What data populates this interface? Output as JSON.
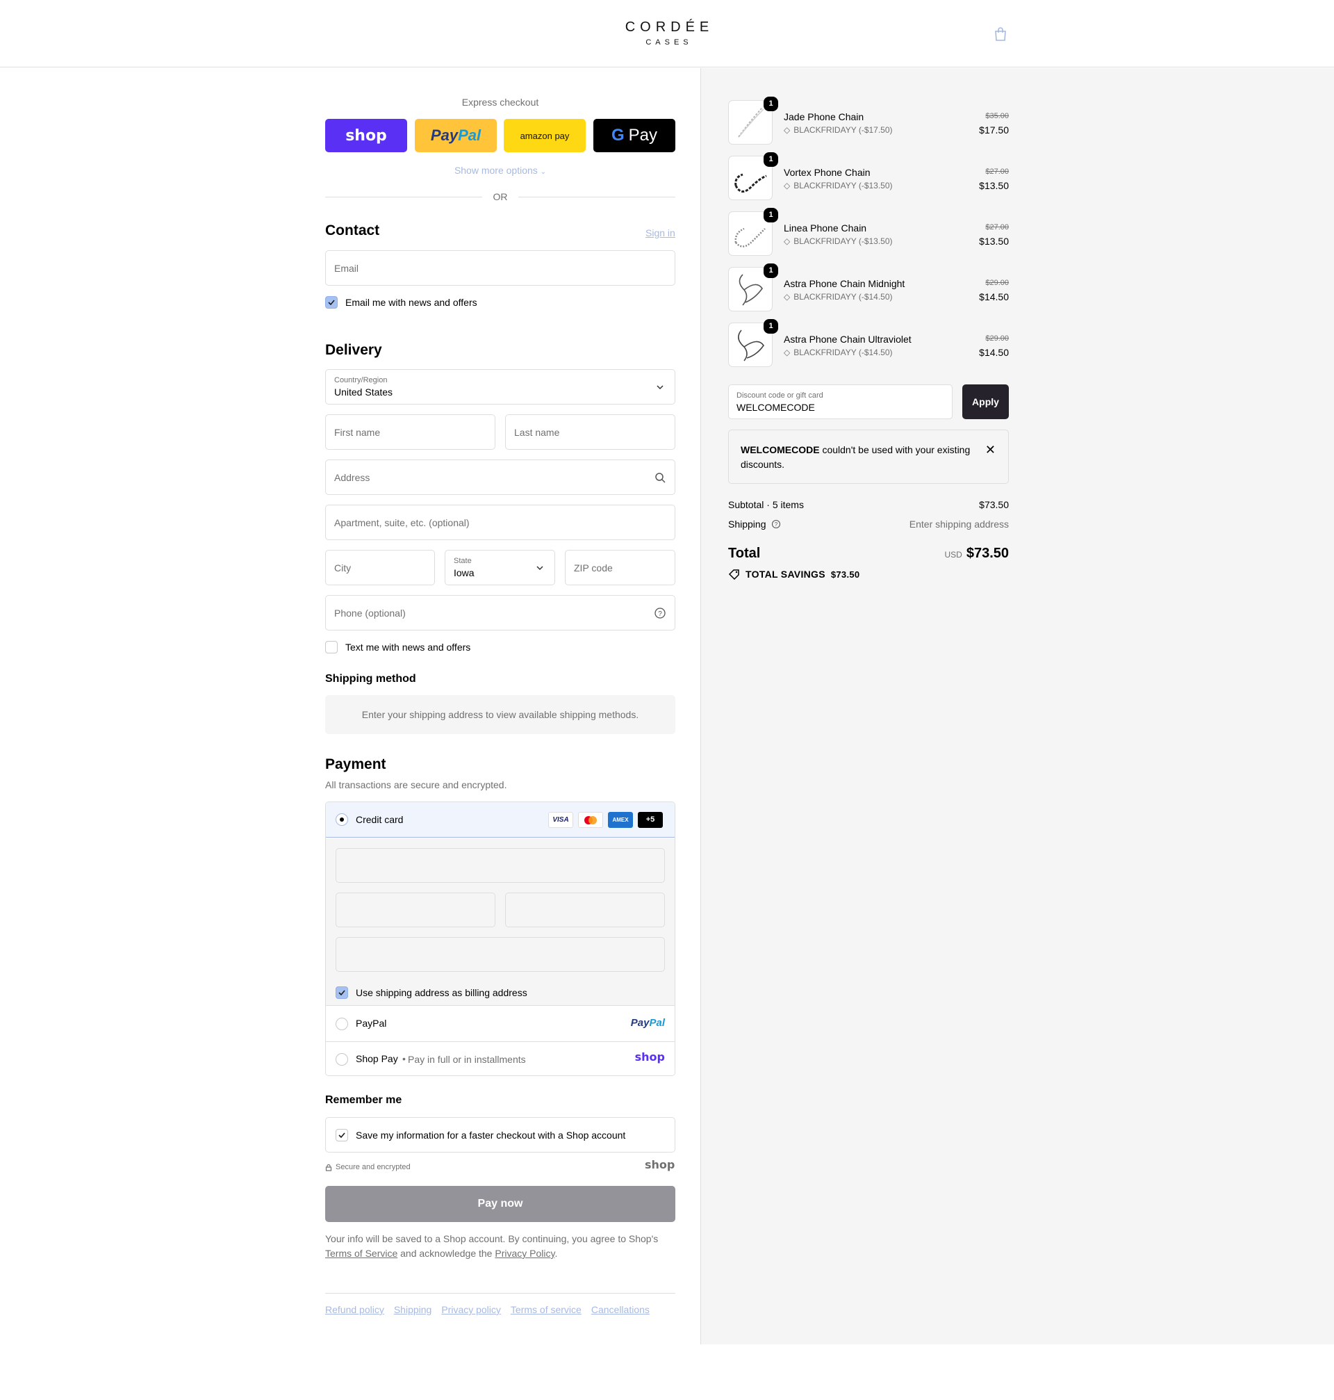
{
  "brand": {
    "name": "CORDÉE",
    "sub": "CASES"
  },
  "express": {
    "title": "Express checkout",
    "shop": "shop",
    "paypal_a": "Pay",
    "paypal_b": "Pal",
    "amazon": "amazon pay",
    "gpay": "Pay",
    "show_more": "Show more options",
    "or": "OR"
  },
  "contact": {
    "title": "Contact",
    "sign_in": "Sign in",
    "email_placeholder": "Email",
    "news_label": "Email me with news and offers"
  },
  "delivery": {
    "title": "Delivery",
    "country_label": "Country/Region",
    "country_value": "United States",
    "first_name": "First name",
    "last_name": "Last name",
    "address": "Address",
    "apartment": "Apartment, suite, etc. (optional)",
    "city": "City",
    "state_label": "State",
    "state_value": "Iowa",
    "zip": "ZIP code",
    "phone": "Phone (optional)",
    "text_label": "Text me with news and offers"
  },
  "shipping_method": {
    "title": "Shipping method",
    "message": "Enter your shipping address to view available shipping methods."
  },
  "payment": {
    "title": "Payment",
    "subtitle": "All transactions are secure and encrypted.",
    "credit_card": "Credit card",
    "cards": [
      "VISA",
      "",
      "AMEX",
      "+5"
    ],
    "billing_label": "Use shipping address as billing address",
    "paypal": "PayPal",
    "paypal_logo_a": "Pay",
    "paypal_logo_b": "Pal",
    "shop_pay": "Shop Pay",
    "shop_pay_sub": "Pay in full or in installments",
    "shop_logo": "shop"
  },
  "remember": {
    "title": "Remember me",
    "save_label": "Save my information for a faster checkout with a Shop account",
    "secure": "Secure and encrypted",
    "shop_logo": "shop"
  },
  "pay_now": "Pay now",
  "legal": {
    "pre": "Your info will be saved to a Shop account. By continuing, you agree to Shop's",
    "terms": "Terms of Service",
    "mid": "and acknowledge the",
    "privacy": "Privacy Policy",
    "end": "."
  },
  "footer_links": [
    "Refund policy",
    "Shipping",
    "Privacy policy",
    "Terms of service",
    "Cancellations"
  ],
  "items": [
    {
      "name": "Jade Phone Chain",
      "qty": "1",
      "discount": "BLACKFRIDAYY (-$17.50)",
      "old": "$35.00",
      "price": "$17.50"
    },
    {
      "name": "Vortex Phone Chain",
      "qty": "1",
      "discount": "BLACKFRIDAYY (-$13.50)",
      "old": "$27.00",
      "price": "$13.50"
    },
    {
      "name": "Linea Phone Chain",
      "qty": "1",
      "discount": "BLACKFRIDAYY (-$13.50)",
      "old": "$27.00",
      "price": "$13.50"
    },
    {
      "name": "Astra Phone Chain Midnight",
      "qty": "1",
      "discount": "BLACKFRIDAYY (-$14.50)",
      "old": "$29.00",
      "price": "$14.50"
    },
    {
      "name": "Astra Phone Chain Ultraviolet",
      "qty": "1",
      "discount": "BLACKFRIDAYY (-$14.50)",
      "old": "$29.00",
      "price": "$14.50"
    }
  ],
  "discount": {
    "label": "Discount code or gift card",
    "value": "WELCOMECODE",
    "apply": "Apply",
    "error_code": "WELCOMECODE",
    "error_text": "couldn't be used with your existing discounts."
  },
  "summary": {
    "subtotal_label": "Subtotal · 5 items",
    "subtotal": "$73.50",
    "shipping_label": "Shipping",
    "shipping_value": "Enter shipping address",
    "total_label": "Total",
    "currency": "USD",
    "total": "$73.50",
    "savings_label": "TOTAL SAVINGS",
    "savings": "$73.50"
  },
  "colors": {
    "shop_purple": "#5a31f4",
    "paypal_yellow": "#ffc439",
    "amazon_yellow": "#ffd814",
    "link_blue": "#a6b9e4",
    "pay_button": "#939399",
    "apply_button": "#25222b"
  }
}
